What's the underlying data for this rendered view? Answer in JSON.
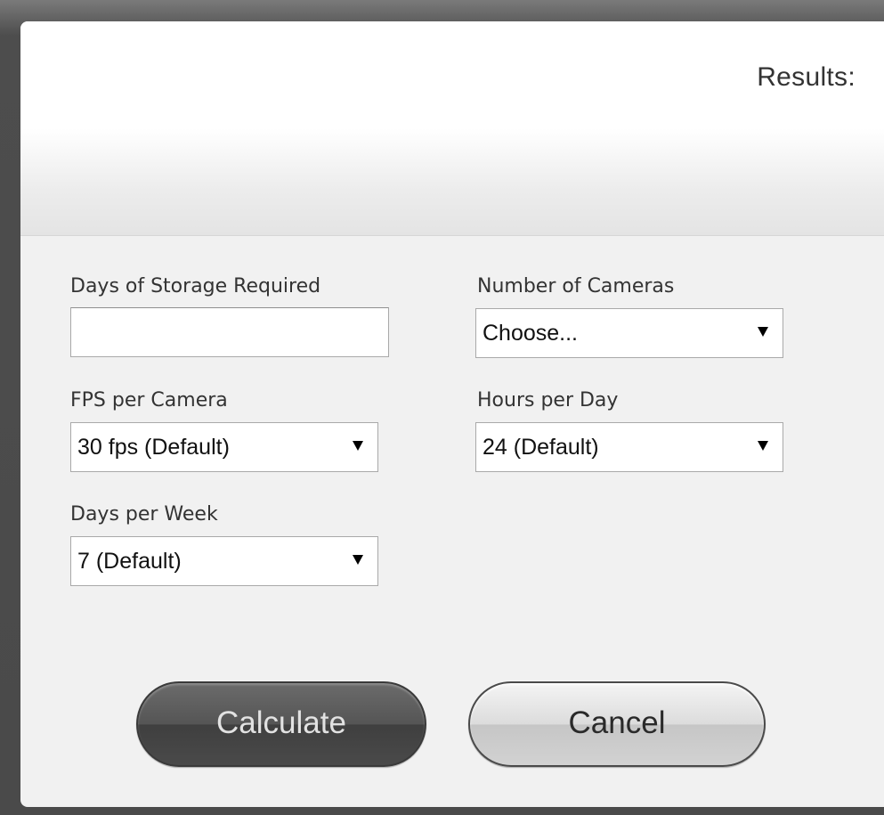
{
  "header": {
    "results_label": "Results:"
  },
  "form": {
    "days_of_storage": {
      "label": "Days of Storage Required",
      "value": ""
    },
    "number_of_cameras": {
      "label": "Number of Cameras",
      "selected": "Choose..."
    },
    "fps_per_camera": {
      "label": "FPS per Camera",
      "selected": "30 fps (Default)"
    },
    "hours_per_day": {
      "label": "Hours per Day",
      "selected": "24 (Default)"
    },
    "days_per_week": {
      "label": "Days per Week",
      "selected": "7 (Default)"
    }
  },
  "buttons": {
    "calculate": "Calculate",
    "cancel": "Cancel"
  },
  "icons": {
    "dropdown": "caret-down-icon"
  }
}
